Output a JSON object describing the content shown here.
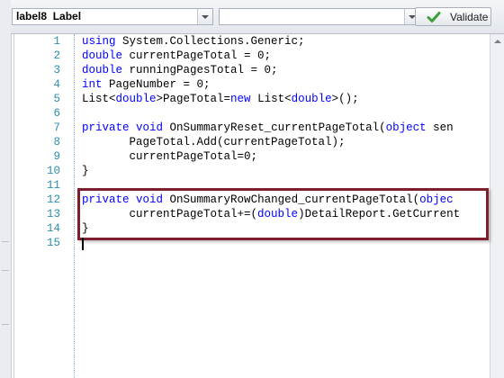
{
  "toolbar": {
    "object_combo_value": "label8  Label",
    "event_combo_value": "",
    "validate_label": "Validate"
  },
  "colors": {
    "keyword": "#0000ff",
    "line_number": "#2b91af",
    "highlight_border": "#7d1f2e",
    "validate_check": "#3aa13a"
  },
  "editor": {
    "lines": [
      {
        "n": "1",
        "code": [
          {
            "t": "using",
            "k": true
          },
          {
            "t": " System.Collections.Generic;"
          }
        ]
      },
      {
        "n": "2",
        "code": [
          {
            "t": "double",
            "k": true
          },
          {
            "t": " currentPageTotal = 0;"
          }
        ]
      },
      {
        "n": "3",
        "code": [
          {
            "t": "double",
            "k": true
          },
          {
            "t": " runningPagesTotal = 0;"
          }
        ]
      },
      {
        "n": "4",
        "code": [
          {
            "t": "int",
            "k": true
          },
          {
            "t": " PageNumber = 0;"
          }
        ]
      },
      {
        "n": "5",
        "code": [
          {
            "t": "List<"
          },
          {
            "t": "double",
            "k": true
          },
          {
            "t": ">PageTotal="
          },
          {
            "t": "new",
            "k": true
          },
          {
            "t": " List<"
          },
          {
            "t": "double",
            "k": true
          },
          {
            "t": ">();"
          }
        ]
      },
      {
        "n": "6",
        "code": []
      },
      {
        "n": "7",
        "code": [
          {
            "t": "private",
            "k": true
          },
          {
            "t": " "
          },
          {
            "t": "void",
            "k": true
          },
          {
            "t": " OnSummaryReset_currentPageTotal("
          },
          {
            "t": "object",
            "k": true
          },
          {
            "t": " sen"
          }
        ]
      },
      {
        "n": "8",
        "code": [
          {
            "t": "       PageTotal.Add(currentPageTotal);"
          }
        ]
      },
      {
        "n": "9",
        "code": [
          {
            "t": "       currentPageTotal=0;"
          }
        ]
      },
      {
        "n": "10",
        "code": [
          {
            "t": "}"
          }
        ]
      },
      {
        "n": "11",
        "code": []
      },
      {
        "n": "12",
        "code": [
          {
            "t": "private",
            "k": true
          },
          {
            "t": " "
          },
          {
            "t": "void",
            "k": true
          },
          {
            "t": " OnSummaryRowChanged_currentPageTotal("
          },
          {
            "t": "objec",
            "k": true
          }
        ]
      },
      {
        "n": "13",
        "code": [
          {
            "t": "       currentPageTotal+=("
          },
          {
            "t": "double",
            "k": true
          },
          {
            "t": ")DetailReport.GetCurrent"
          }
        ]
      },
      {
        "n": "14",
        "code": [
          {
            "t": "}"
          }
        ]
      },
      {
        "n": "15",
        "code": []
      }
    ]
  }
}
